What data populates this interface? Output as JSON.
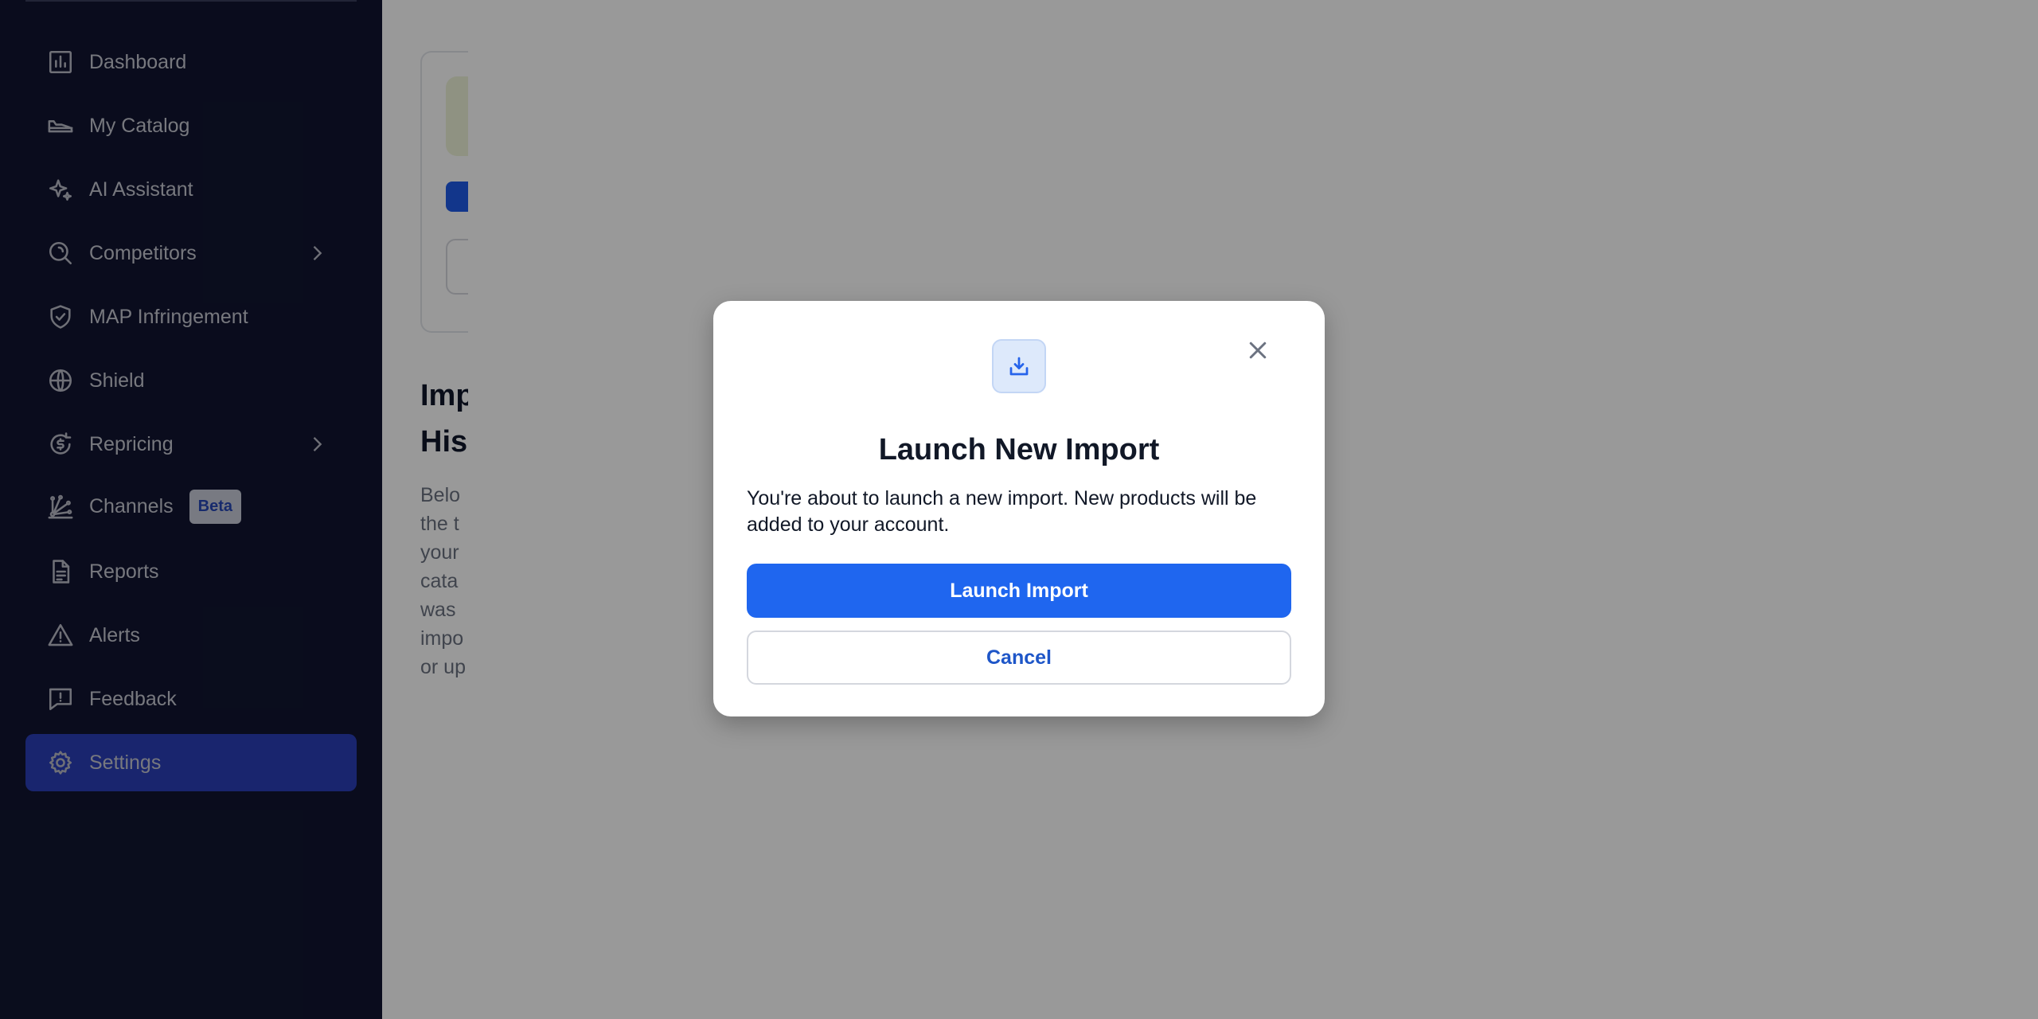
{
  "sidebar": {
    "items": [
      {
        "label": "Dashboard",
        "icon": "bar-chart-icon"
      },
      {
        "label": "My Catalog",
        "icon": "shoe-icon"
      },
      {
        "label": "AI Assistant",
        "icon": "sparkle-icon"
      },
      {
        "label": "Competitors",
        "icon": "search-radar-icon",
        "has_chevron": true
      },
      {
        "label": "MAP Infringement",
        "icon": "shield-check-icon"
      },
      {
        "label": "Shield",
        "icon": "globe-icon"
      },
      {
        "label": "Repricing",
        "icon": "dollar-cycle-icon",
        "has_chevron": true
      },
      {
        "label": "Channels",
        "icon": "network-icon",
        "badge": "Beta"
      },
      {
        "label": "Reports",
        "icon": "document-icon"
      },
      {
        "label": "Alerts",
        "icon": "warning-icon"
      },
      {
        "label": "Feedback",
        "icon": "feedback-icon"
      },
      {
        "label": "Settings",
        "icon": "gear-icon",
        "active": true
      }
    ]
  },
  "main": {
    "section_title_line1": "Imp",
    "section_title_line2": "His",
    "description_lines": [
      "Belo",
      "the t",
      "your",
      "cata",
      "was",
      "impo",
      "or up"
    ]
  },
  "modal": {
    "icon": "download-icon",
    "title": "Launch New Import",
    "body": "You're about to launch a new import. New products will be added to your account.",
    "primary_label": "Launch Import",
    "secondary_label": "Cancel"
  },
  "colors": {
    "sidebar_bg": "#111531",
    "active_item": "#2a3fb8",
    "primary_button": "#1f66ef",
    "overlay": "rgba(0,0,0,0.4)"
  }
}
